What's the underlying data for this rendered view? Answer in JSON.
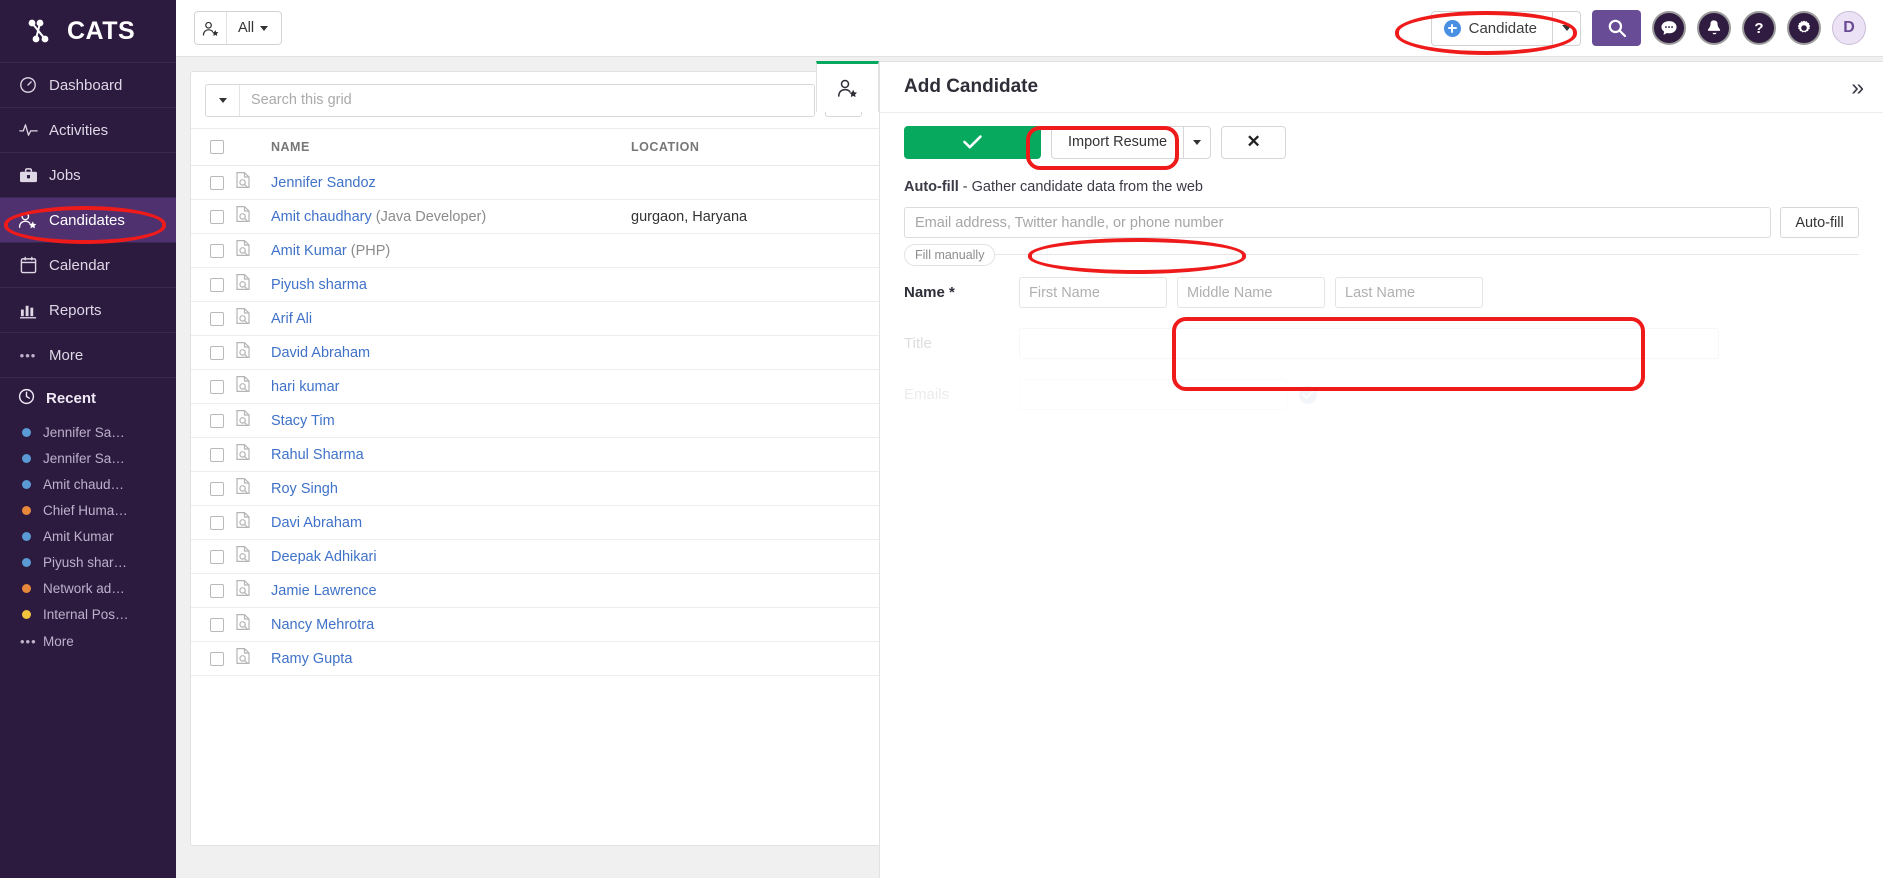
{
  "brand": {
    "name": "CATS"
  },
  "sidebar": {
    "items": [
      {
        "label": "Dashboard",
        "icon": "gauge-icon",
        "active": false
      },
      {
        "label": "Activities",
        "icon": "pulse-icon",
        "active": false
      },
      {
        "label": "Jobs",
        "icon": "briefcase-icon",
        "active": false
      },
      {
        "label": "Candidates",
        "icon": "user-star-icon",
        "active": true
      },
      {
        "label": "Calendar",
        "icon": "calendar-icon",
        "active": false
      },
      {
        "label": "Reports",
        "icon": "bar-chart-icon",
        "active": false
      },
      {
        "label": "More",
        "icon": "ellipsis-icon",
        "active": false
      }
    ],
    "recent": {
      "label": "Recent",
      "items": [
        {
          "label": "Jennifer Sa…",
          "color": "#5b9bd5"
        },
        {
          "label": "Jennifer Sa…",
          "color": "#5b9bd5"
        },
        {
          "label": "Amit chaud…",
          "color": "#5b9bd5"
        },
        {
          "label": "Chief Huma…",
          "color": "#e8883a"
        },
        {
          "label": "Amit Kumar",
          "color": "#5b9bd5"
        },
        {
          "label": "Piyush shar…",
          "color": "#5b9bd5"
        },
        {
          "label": "Network ad…",
          "color": "#e8883a"
        },
        {
          "label": "Internal Pos…",
          "color": "#f2c33c"
        }
      ],
      "more_label": "More"
    }
  },
  "topbar": {
    "view_filter_label": "All",
    "view_filter_icon": "user-star-icon",
    "add_candidate_label": "Candidate",
    "add_candidate_icon": "plus-circle-icon",
    "icons": [
      {
        "name": "search-icon",
        "glyph": "search"
      },
      {
        "name": "chat-icon",
        "glyph": "chat"
      },
      {
        "name": "bell-icon",
        "glyph": "bell"
      },
      {
        "name": "help-icon",
        "glyph": "question"
      },
      {
        "name": "gear-icon",
        "glyph": "gear"
      }
    ],
    "avatar_initial": "D"
  },
  "grid": {
    "search_placeholder": "Search this grid",
    "add_button_icon": "green-plus-icon",
    "columns": [
      "NAME",
      "LOCATION"
    ],
    "rows": [
      {
        "name": "Jennifer Sandoz",
        "sub": "",
        "location": ""
      },
      {
        "name": "Amit chaudhary",
        "sub": "(Java Developer)",
        "location": "gurgaon, Haryana"
      },
      {
        "name": "Amit Kumar",
        "sub": "(PHP)",
        "location": ""
      },
      {
        "name": "Piyush sharma",
        "sub": "",
        "location": ""
      },
      {
        "name": "Arif Ali",
        "sub": "",
        "location": ""
      },
      {
        "name": "David Abraham",
        "sub": "",
        "location": ""
      },
      {
        "name": "hari kumar",
        "sub": "",
        "location": ""
      },
      {
        "name": "Stacy Tim",
        "sub": "",
        "location": ""
      },
      {
        "name": "Rahul Sharma",
        "sub": "",
        "location": ""
      },
      {
        "name": "Roy Singh",
        "sub": "",
        "location": ""
      },
      {
        "name": "Davi Abraham",
        "sub": "",
        "location": ""
      },
      {
        "name": "Deepak Adhikari",
        "sub": "",
        "location": ""
      },
      {
        "name": "Jamie Lawrence",
        "sub": "",
        "location": ""
      },
      {
        "name": "Nancy Mehrotra",
        "sub": "",
        "location": ""
      },
      {
        "name": "Ramy Gupta",
        "sub": "",
        "location": ""
      }
    ]
  },
  "panel": {
    "tab_icon": "user-star-icon",
    "title": "Add Candidate",
    "collapse_icon": "chevron-double-right-icon",
    "save_label": "",
    "save_icon": "check-icon",
    "import_resume_label": "Import Resume",
    "close_label": "✕",
    "autofill": {
      "heading_bold": "Auto-fill",
      "heading_rest": " - Gather candidate data from the web",
      "placeholder": "Email address, Twitter handle, or phone number",
      "value": "",
      "button_label": "Auto-fill"
    },
    "fill_manually_legend": "Fill manually",
    "fields": {
      "name_label": "Name *",
      "first_placeholder": "First Name",
      "middle_placeholder": "Middle Name",
      "last_placeholder": "Last Name",
      "first_value": "",
      "middle_value": "",
      "last_value": "",
      "title_label": "Title",
      "title_value": "",
      "emails_label": "Emails",
      "emails_value": "",
      "emails_check_icon": "check-circle-icon"
    }
  },
  "colors": {
    "sidebar_bg": "#2d1b3f",
    "sidebar_active": "#503170",
    "accent_purple": "#684d96",
    "green": "#06a95e",
    "link_blue": "#3f72c8",
    "annotation_red": "#ef1b1b"
  }
}
